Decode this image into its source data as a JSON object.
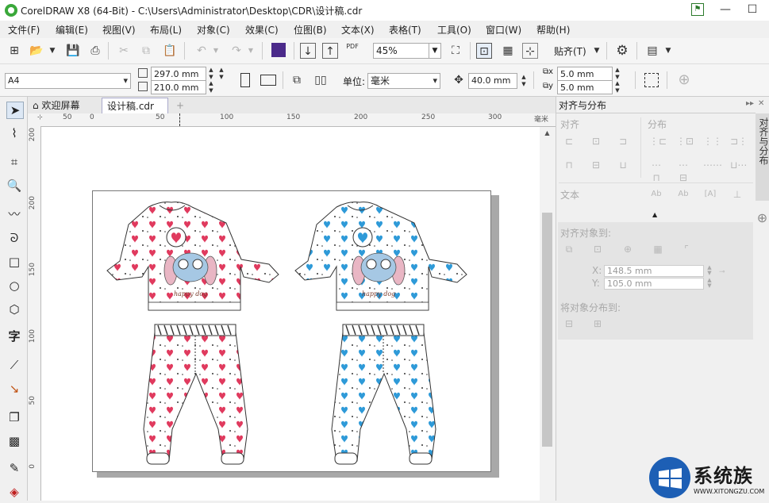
{
  "window": {
    "title": "CorelDRAW X8 (64-Bit) - C:\\Users\\Administrator\\Desktop\\CDR\\设计稿.cdr",
    "minimize": "—",
    "maximize": "☐",
    "close": "✕"
  },
  "menu": [
    "文件(F)",
    "编辑(E)",
    "视图(V)",
    "布局(L)",
    "对象(C)",
    "效果(C)",
    "位图(B)",
    "文本(X)",
    "表格(T)",
    "工具(O)",
    "窗口(W)",
    "帮助(H)"
  ],
  "toolbar": {
    "zoom": "45%",
    "snap_label": "贴齐(T)",
    "pdf_label": "PDF"
  },
  "property_bar": {
    "page_size": "A4",
    "width": "297.0 mm",
    "height": "210.0 mm",
    "units_label": "单位:",
    "units_value": "毫米",
    "nudge": "40.0 mm",
    "dup_x": "5.0 mm",
    "dup_y": "5.0 mm"
  },
  "tabs": {
    "welcome": "欢迎屏幕",
    "document": "设计稿.cdr",
    "add": "+"
  },
  "ruler": {
    "unit": "毫米",
    "h_ticks": [
      "50",
      "0",
      "50",
      "100",
      "150",
      "200",
      "250",
      "300"
    ],
    "v_ticks": [
      "200",
      "150",
      "100",
      "50",
      "0"
    ]
  },
  "docker": {
    "title": "对齐与分布",
    "align": "对齐",
    "distribute": "分布",
    "text": "文本",
    "align_to": "对齐对象到:",
    "x_label": "X:",
    "x_value": "148.5 mm",
    "y_label": "Y:",
    "y_value": "105.0 mm",
    "distribute_to": "将对象分布到:",
    "side_tab": "对齐与分布"
  },
  "artwork": {
    "left_outfit_color": "#e03a5e",
    "right_outfit_color": "#2e9ad8",
    "text_on_shirt": "happy dog"
  },
  "watermark": {
    "brand": "系统族",
    "url": "WWW.XITONGZU.COM"
  }
}
